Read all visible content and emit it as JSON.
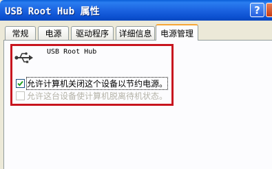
{
  "window": {
    "title": "USB Root Hub 属性"
  },
  "title_buttons": {
    "help_glyph": "?",
    "close_glyph": "×"
  },
  "tabs": [
    {
      "label": "常规",
      "active": false
    },
    {
      "label": "电源",
      "active": false
    },
    {
      "label": "驱动程序",
      "active": false
    },
    {
      "label": "详细信息",
      "active": false
    },
    {
      "label": "电源管理",
      "active": true
    }
  ],
  "device": {
    "name": "USB Root Hub",
    "icon": "usb-icon"
  },
  "options": [
    {
      "label": "允许计算机关闭这个设备以节约电源。",
      "checked": true,
      "enabled": true
    },
    {
      "label": "允许这台设备使计算机脱离待机状态。",
      "checked": false,
      "enabled": false
    }
  ],
  "colors": {
    "titlebar": "#1b63e0",
    "highlight_border": "#c8141e",
    "active_tab_accent": "#f7a535",
    "dialog_bg": "#ece9d8"
  }
}
